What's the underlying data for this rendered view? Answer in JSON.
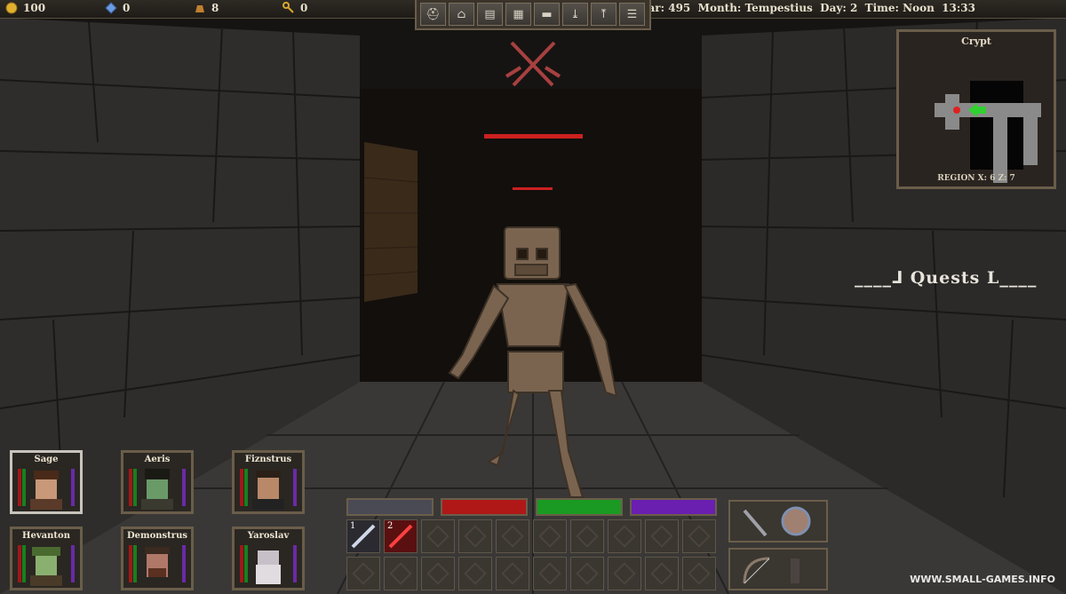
{
  "resources": [
    {
      "icon": "gold-coin-icon",
      "value": "100"
    },
    {
      "icon": "gem-icon",
      "value": "0"
    },
    {
      "icon": "money-bag-icon",
      "value": "8"
    },
    {
      "icon": "key-icon",
      "value": "0"
    }
  ],
  "date": {
    "year_label": "Year:",
    "year": "495",
    "month_label": "Month:",
    "month": "Tempestius",
    "day_label": "Day:",
    "day": "2",
    "time_label": "Time:",
    "time": "Noon",
    "clock": "13:33"
  },
  "toolbar": [
    "helmet-icon",
    "home-icon",
    "journal-icon",
    "map-icon",
    "anvil-icon",
    "download-icon",
    "upload-icon",
    "settings-icon"
  ],
  "minimap": {
    "title": "Crypt",
    "region": "REGION X: 6 Z: 7"
  },
  "quests": {
    "label": "Quests",
    "left_deco": "____⅃",
    "right_deco": "Ⅼ____"
  },
  "enemy_health": [
    1.0,
    1.0
  ],
  "party": [
    {
      "name": "Sage",
      "selected": true
    },
    {
      "name": "Aeris",
      "selected": false
    },
    {
      "name": "Fiznstrus",
      "selected": false
    },
    {
      "name": "Hevanton",
      "selected": false
    },
    {
      "name": "Demonstrus",
      "selected": false
    },
    {
      "name": "Yaroslav",
      "selected": false
    }
  ],
  "stat_bar_colors": [
    "#4a4a55",
    "#b01818",
    "#1a9a22",
    "#6a1fb0"
  ],
  "skills": [
    {
      "number": "1",
      "icon": "slash-icon"
    },
    {
      "number": "2",
      "icon": "fire-slash-icon"
    }
  ],
  "equipment": [
    "sword-icon",
    "round-shield-icon",
    "bow-icon",
    "quiver-icon"
  ],
  "watermark": "WWW.SMALL-GAMES.INFO"
}
